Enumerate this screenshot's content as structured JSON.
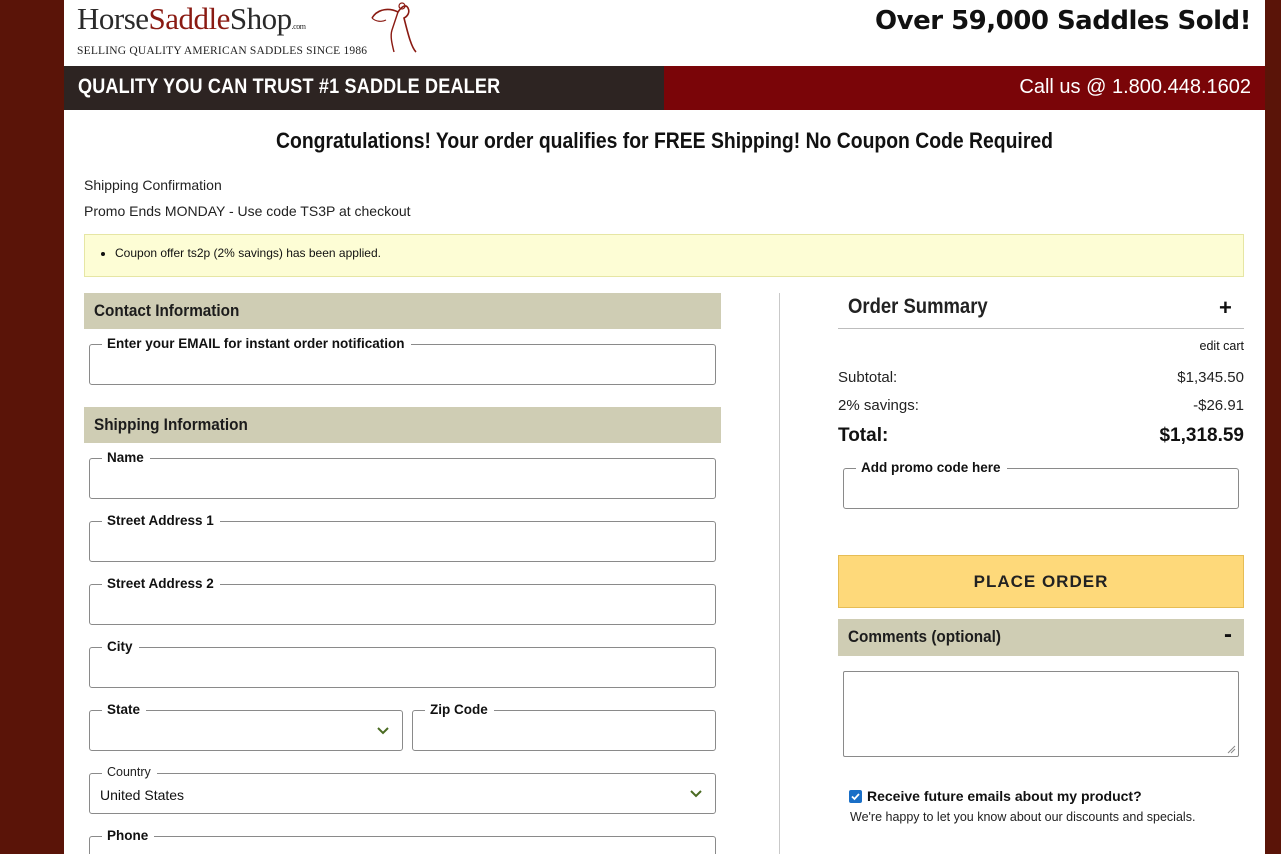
{
  "header": {
    "logo": {
      "part1": "Horse",
      "part2": "Saddle",
      "part3": "Shop",
      "suffix": ".com",
      "tagline": "SELLING QUALITY AMERICAN SADDLES SINCE 1986"
    },
    "saddles_sold": "Over 59,000 Saddles Sold!",
    "bar_left": "QUALITY YOU CAN TRUST #1 SADDLE DEALER",
    "bar_phone": "Call us @ 1.800.448.1602"
  },
  "banner": "Congratulations! Your order qualifies for FREE Shipping! No Coupon Code Required",
  "shipping_confirmation": "Shipping Confirmation",
  "promo_text": "Promo Ends MONDAY - Use code TS3P at checkout",
  "coupon_notice": "Coupon offer ts2p (2% savings) has been applied.",
  "contact": {
    "heading": "Contact Information",
    "email_label": "Enter your EMAIL for instant order notification",
    "email_value": ""
  },
  "shipping": {
    "heading": "Shipping Information",
    "name_label": "Name",
    "street1_label": "Street Address 1",
    "street2_label": "Street Address 2",
    "city_label": "City",
    "state_label": "State",
    "state_value": "",
    "zip_label": "Zip Code",
    "country_label": "Country",
    "country_value": "United States",
    "phone_label": "Phone"
  },
  "summary": {
    "heading": "Order Summary",
    "toggle": "+",
    "edit_cart": "edit cart",
    "subtotal_label": "Subtotal:",
    "subtotal_value": "$1,345.50",
    "savings_label": "2% savings:",
    "savings_value": "-$26.91",
    "total_label": "Total:",
    "total_value": "$1,318.59",
    "promo_label": "Add promo code here",
    "place_order": "PLACE ORDER"
  },
  "comments": {
    "heading": "Comments (optional)",
    "toggle": "-",
    "value": ""
  },
  "newsletter": {
    "checked": true,
    "label": "Receive future emails about my product?",
    "sub": "We're happy to let you know about our discounts and specials."
  },
  "colors": {
    "frame": "#5a1408",
    "header_bar": "#2d2422",
    "phone_bar": "#7a0508",
    "section_head": "#cfcdb4",
    "coupon_bg": "#fdfdd5",
    "place_order_bg": "#fed97a",
    "checkbox": "#1a6fc7"
  },
  "icons": {
    "logo_horse": "horse-rider-logo-icon",
    "select_arrow": "chevron-down-icon",
    "checkbox": "checkmark-icon"
  }
}
